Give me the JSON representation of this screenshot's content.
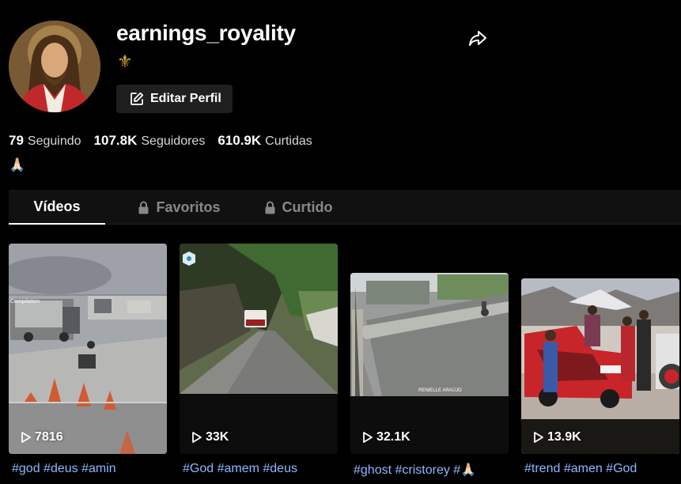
{
  "profile": {
    "username": "earnings_royality",
    "badge_glyph": "⚜",
    "edit_label": "Editar Perfil",
    "bio": "🙏🏻"
  },
  "stats": {
    "following_count": "79",
    "following_label": "Seguindo",
    "followers_count": "107.8K",
    "followers_label": "Seguidores",
    "likes_count": "610.9K",
    "likes_label": "Curtidas"
  },
  "tabs": [
    {
      "label": "Vídeos",
      "active": true,
      "locked": false
    },
    {
      "label": "Favoritos",
      "active": false,
      "locked": true
    },
    {
      "label": "Curtido",
      "active": false,
      "locked": true
    }
  ],
  "videos": [
    {
      "views": "7816",
      "caption": "#god #deus #amin"
    },
    {
      "views": "33K",
      "caption": "#God #amem #deus"
    },
    {
      "views": "32.1K",
      "caption": "#ghost #cristorey #🙏🏻"
    },
    {
      "views": "13.9K",
      "caption": "#trend #amen #God"
    }
  ],
  "thumb_text": {
    "compilation": "Compilation",
    "watermark": "RENIELLE ARAÚJO"
  },
  "colors": {
    "background": "#000000",
    "caption_link": "#8db8ff",
    "tab_active": "#ffffff",
    "tab_inactive": "#888888",
    "button_bg": "#1f1f1f"
  },
  "icons": [
    "share-icon",
    "edit-icon",
    "lock-icon",
    "play-icon",
    "fleur-de-lis-icon"
  ]
}
